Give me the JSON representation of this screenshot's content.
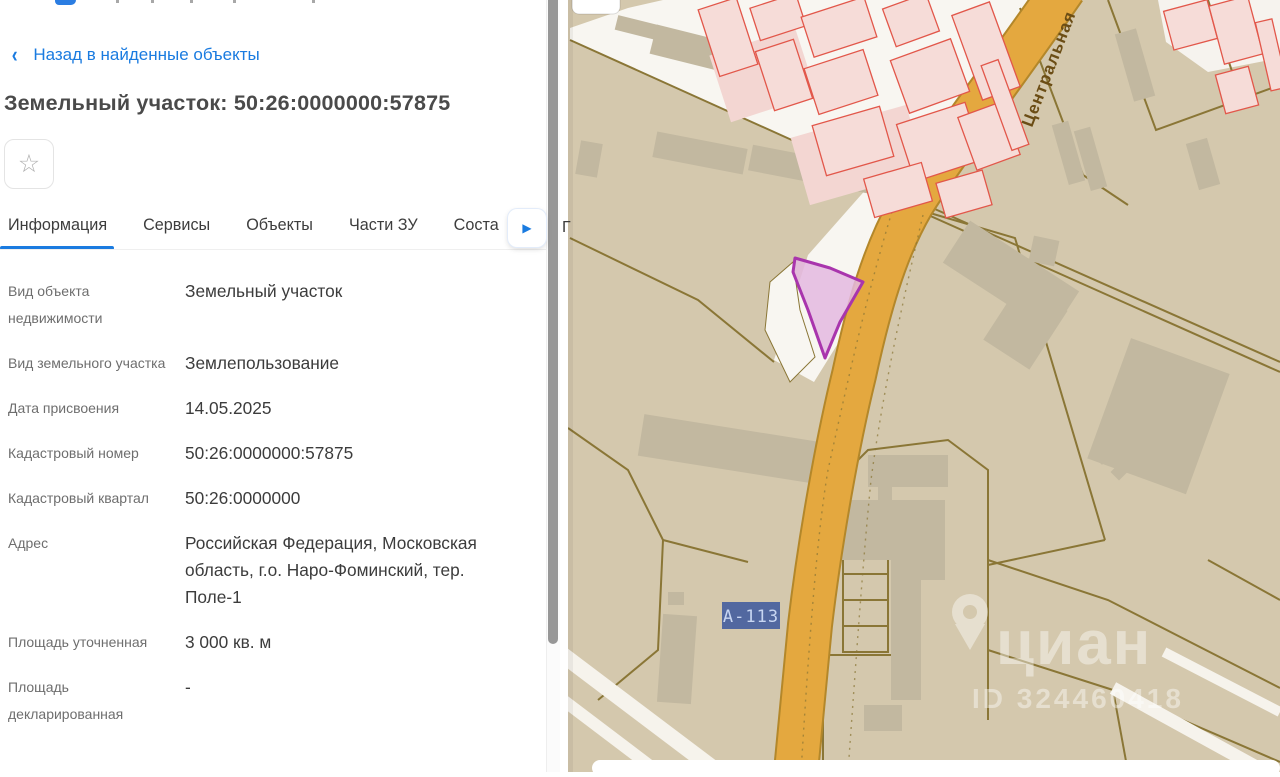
{
  "panel": {
    "back_link": "Назад в найденные объекты",
    "back_chevron": "‹",
    "title": "Земельный участок: 50:26:0000000:57875",
    "favorite_icon": "☆",
    "tabs": [
      {
        "label": "Информация",
        "active": true
      },
      {
        "label": "Сервисы",
        "active": false
      },
      {
        "label": "Объекты",
        "active": false
      },
      {
        "label": "Части ЗУ",
        "active": false
      },
      {
        "label": "Соста",
        "active": false,
        "truncated": true
      }
    ],
    "tab_fragment": "Г",
    "more_tabs_arrow": "▶",
    "fields": [
      {
        "label": "Вид объекта недвижимости",
        "value": "Земельный участок"
      },
      {
        "label": "Вид земельного участка",
        "value": "Землепользование"
      },
      {
        "label": "Дата присвоения",
        "value": "14.05.2025"
      },
      {
        "label": "Кадастровый номер",
        "value": "50:26:0000000:57875"
      },
      {
        "label": "Кадастровый квартал",
        "value": "50:26:0000000"
      },
      {
        "label": "Адрес",
        "value": "Российская Федерация, Московская область, г.о. Наро-Фоминский, тер. Поле-1"
      },
      {
        "label": "Площадь уточненная",
        "value": "3 000 кв. м"
      },
      {
        "label": "Площадь декларированная",
        "value": "-"
      }
    ]
  },
  "map": {
    "street_label": "Центральная",
    "road_badge": "А-113",
    "watermark_brand": "циан",
    "watermark_id": "ID 324460418",
    "colors": {
      "accent_blue": "#1a7be0",
      "map_background": "#d4c8ad",
      "parcel_line": "#8a7636",
      "road_orange": "#e2a43e",
      "road_border": "#b3872a",
      "building_gray": "#c2b8a0",
      "pink_building_fill": "#f6dcd8",
      "pink_building_stroke": "#e2574a",
      "selected_parcel_stroke": "#a935ad",
      "selected_parcel_fill": "#e4b9e0",
      "badge_blue": "#5268a0",
      "street_text": "#6b4d15"
    }
  }
}
